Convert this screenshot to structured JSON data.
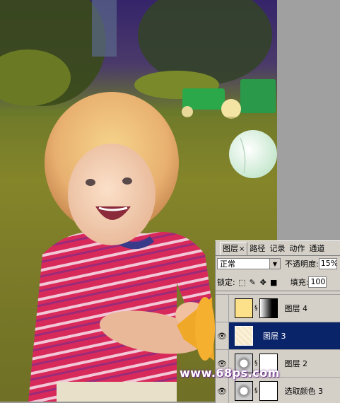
{
  "panel": {
    "tabs": [
      {
        "label": "图层"
      },
      {
        "label": "路径"
      },
      {
        "label": "记录"
      },
      {
        "label": "动作"
      },
      {
        "label": "通道"
      }
    ],
    "tab_close": "×",
    "blend_mode": "正常",
    "opacity_label": "不透明度:",
    "opacity_value": "15%",
    "lock_label": "锁定:",
    "fill_label": "填充:",
    "fill_value": "100%",
    "layers": [
      {
        "name": "图层 4",
        "visible": false,
        "selected": false
      },
      {
        "name": "图层 3",
        "visible": true,
        "selected": true
      },
      {
        "name": "图层 2",
        "visible": true,
        "selected": false
      },
      {
        "name": "选取颜色 3",
        "visible": true,
        "selected": false
      }
    ]
  },
  "watermark": "www.68ps.com",
  "colors": {
    "selection": "#0a246a",
    "panel_bg": "#d4d0c8"
  }
}
